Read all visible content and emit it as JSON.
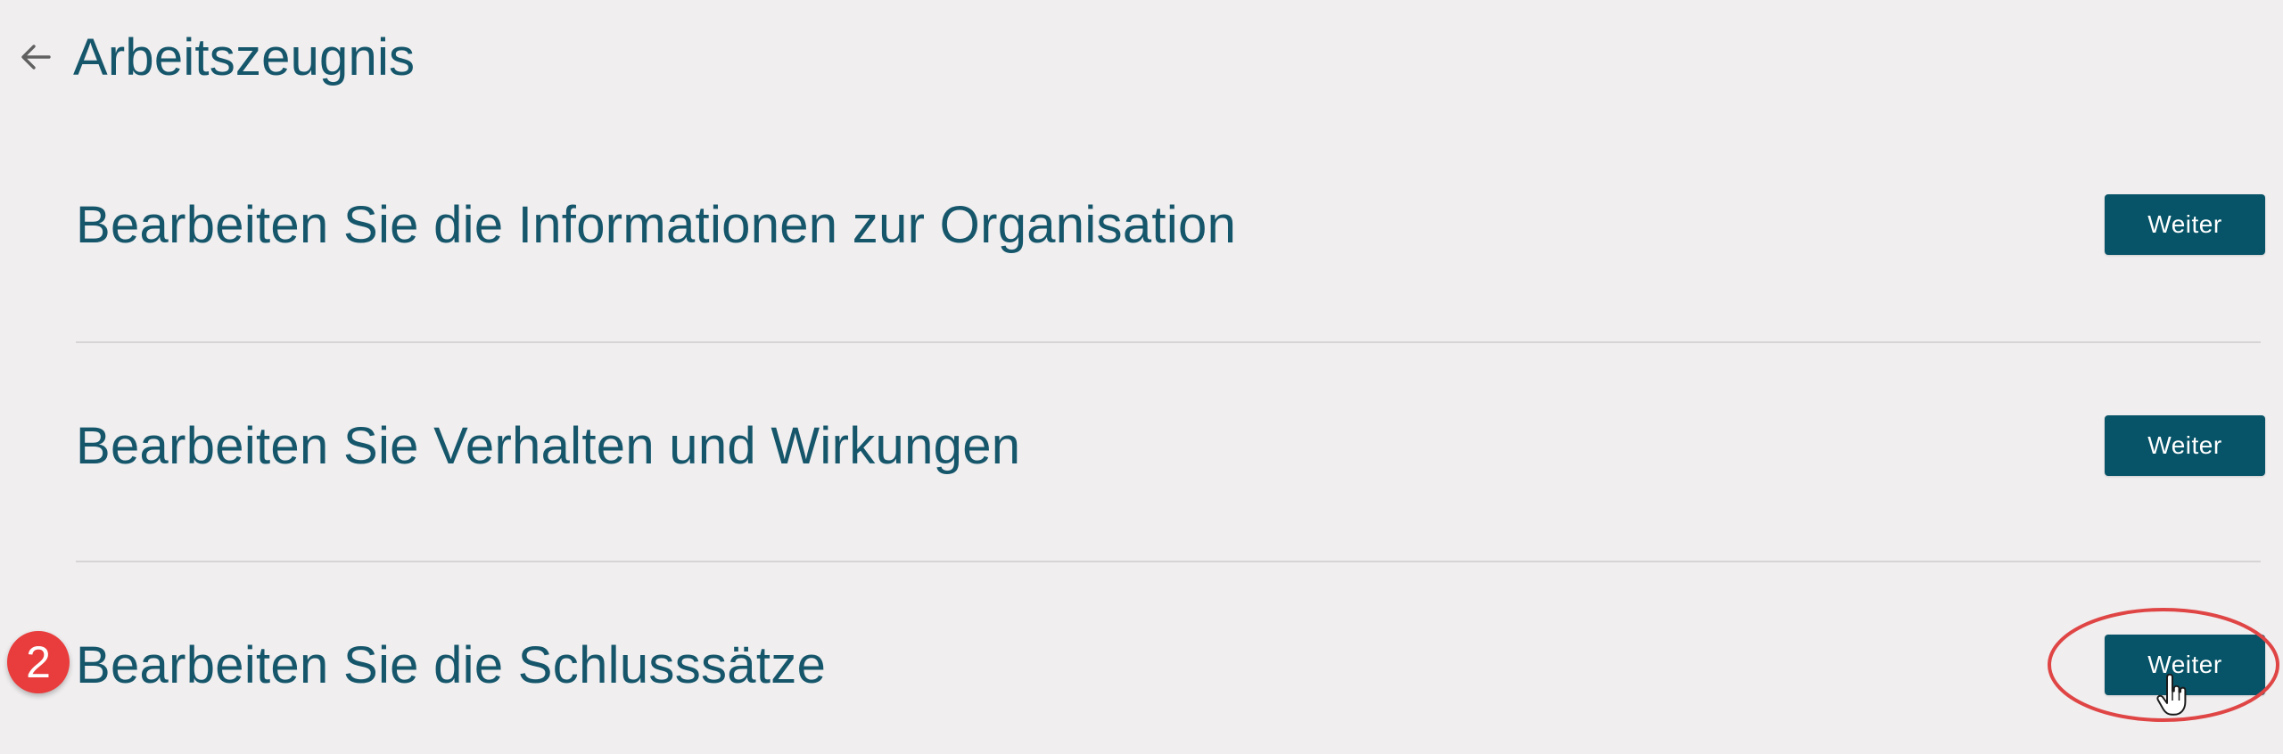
{
  "header": {
    "title": "Arbeitszeugnis",
    "back_icon": "arrow-left-icon"
  },
  "sections": [
    {
      "label": "Bearbeiten Sie die Informationen zur Organisation",
      "button_label": "Weiter"
    },
    {
      "label": "Bearbeiten Sie Verhalten und Wirkungen",
      "button_label": "Weiter"
    },
    {
      "label": "Bearbeiten Sie die Schlusssätze",
      "button_label": "Weiter"
    }
  ],
  "annotation": {
    "step_number": "2",
    "badge_color": "#e93c3c",
    "highlight_color": "#e04545"
  },
  "colors": {
    "background": "#f0eeef",
    "title_text": "#16566b",
    "button_bg": "#075468",
    "button_text": "#ffffff",
    "divider": "#d6d4d5"
  }
}
